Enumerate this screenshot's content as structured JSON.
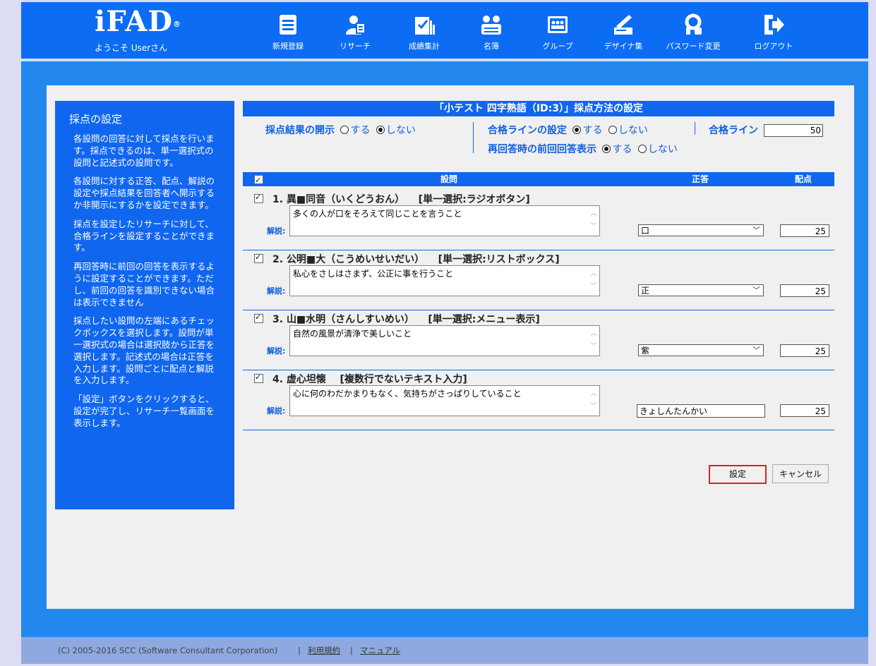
{
  "header": {
    "logo": "iFAD",
    "logo_mark": "®",
    "welcome": "ようこそ Userさん",
    "nav": [
      {
        "label": "新規登録",
        "icon": "new-registration-icon"
      },
      {
        "label": "リサーチ",
        "icon": "research-icon"
      },
      {
        "label": "成績集計",
        "icon": "results-icon"
      },
      {
        "label": "名簿",
        "icon": "roster-icon"
      },
      {
        "label": "グループ",
        "icon": "group-icon"
      },
      {
        "label": "デザイナ集",
        "icon": "designer-icon"
      },
      {
        "label": "パスワード変更",
        "icon": "password-icon"
      },
      {
        "label": "ログアウト",
        "icon": "logout-icon"
      }
    ]
  },
  "sidebar": {
    "title": "採点の設定",
    "paragraphs": [
      "各設問の回答に対して採点を行います。採点できるのは、単一選択式の設問と記述式の設問です。",
      "各設問に対する正答、配点、解説の設定や採点結果を回答者へ開示するか非開示にするかを設定できます。",
      "採点を設定したリサーチに対して、合格ラインを設定することができます。",
      "再回答時に前回の回答を表示するように設定することができます。ただし、前回の回答を識別できない場合は表示できません",
      "採点したい設問の左端にあるチェックボックスを選択します。設問が単一選択式の場合は選択肢から正答を選択します。記述式の場合は正答を入力します。設問ごとに配点と解説を入力します。",
      "「設定」ボタンをクリックすると、設定が完了し、リサーチ一覧画面を表示します。"
    ]
  },
  "main": {
    "title": "「小テスト 四字熟語（ID:3）」採点方法の設定",
    "disclose": {
      "label": "採点結果の開示",
      "opt_yes": "する",
      "opt_no": "しない",
      "selected": "no"
    },
    "pass_setting": {
      "label": "合格ラインの設定",
      "opt_yes": "する",
      "opt_no": "しない",
      "selected": "yes"
    },
    "pass_line": {
      "label": "合格ライン",
      "value": "50"
    },
    "previous": {
      "label": "再回答時の前回回答表示",
      "opt_yes": "する",
      "opt_no": "しない",
      "selected": "yes"
    },
    "table": {
      "col_question": "設問",
      "col_answer": "正答",
      "col_points": "配点",
      "explain_label": "解説:",
      "rows": [
        {
          "no": "1.",
          "text": "異■同音（いくどうおん）",
          "type": "[単一選択:ラジオボタン]",
          "explanation": "多くの人が口をそろえて同じことを言うこと",
          "answer": "口",
          "answer_kind": "select",
          "points": "25"
        },
        {
          "no": "2.",
          "text": "公明■大（こうめいせいだい）",
          "type": "[単一選択:リストボックス]",
          "explanation": "私心をさしはさまず、公正に事を行うこと",
          "answer": "正",
          "answer_kind": "select",
          "points": "25"
        },
        {
          "no": "3.",
          "text": "山■水明（さんしすいめい）",
          "type": "[単一選択:メニュー表示]",
          "explanation": "自然の風景が清浄で美しいこと",
          "answer": "紫",
          "answer_kind": "select",
          "points": "25"
        },
        {
          "no": "4.",
          "text": "虚心坦懐",
          "type": "[複数行でないテキスト入力]",
          "explanation": "心に何のわだかまりもなく、気持ちがさっぱりしていること",
          "answer": "きょしんたんかい",
          "answer_kind": "text",
          "points": "25"
        }
      ]
    },
    "buttons": {
      "submit": "設定",
      "cancel": "キャンセル"
    }
  },
  "footer": {
    "copyright": "(C) 2005-2016 SCC (Software Consultant Corporation)",
    "sep": "|",
    "terms": "利用規約",
    "manual": "マニュアル"
  }
}
